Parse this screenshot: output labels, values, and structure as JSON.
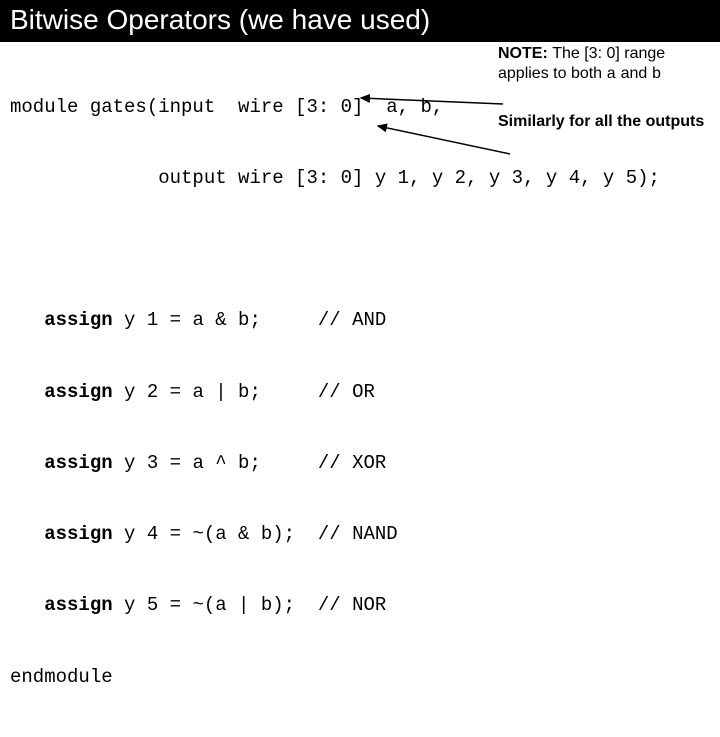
{
  "title": "Bitwise Operators (we have used)",
  "code": {
    "l1a": "module gates(input  wire [3: 0]  a, b,",
    "l1b": "             output wire [3: 0] y 1, y 2, y 3, y 4, y 5);",
    "blank1": " ",
    "a1a": "   assign",
    "a1b": " y 1 = a & b;     // AND",
    "a2a": "   assign",
    "a2b": " y 2 = a | b;     // OR",
    "a3a": "   assign",
    "a3b": " y 3 = a ^ b;     // XOR",
    "a4a": "   assign",
    "a4b": " y 4 = ~(a & b);  // NAND",
    "a5a": "   assign",
    "a5b": " y 5 = ~(a | b);  // NOR",
    "end": "endmodule"
  },
  "note": {
    "prefix": "NOTE:  ",
    "body1": "The ",
    "range": "[3: 0]",
    "body2": " range applies to both ",
    "a": "a",
    "body3": " and ",
    "b": "b",
    "sub": "Similarly for all the outputs"
  }
}
